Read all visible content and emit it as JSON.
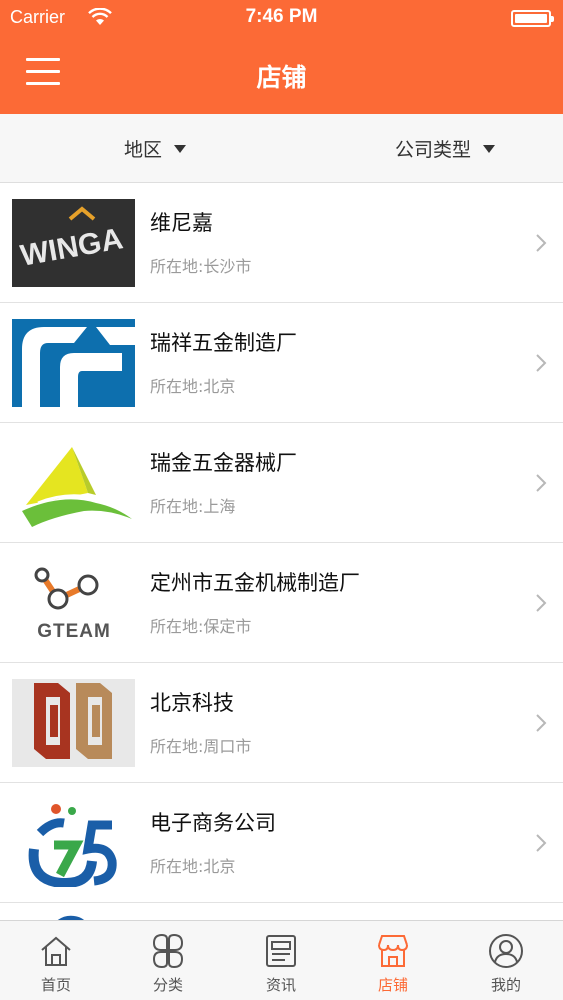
{
  "status_bar": {
    "carrier": "Carrier",
    "time": "7:46 PM"
  },
  "header": {
    "title": "店铺",
    "menu_icon": "hamburger-icon"
  },
  "filters": {
    "region": "地区",
    "company_type": "公司类型"
  },
  "shops": [
    {
      "name": "维尼嘉",
      "location": "所在地:长沙市",
      "logo_text": "WINGA"
    },
    {
      "name": "瑞祥五金制造厂",
      "location": "所在地:北京"
    },
    {
      "name": "瑞金五金器械厂",
      "location": "所在地:上海"
    },
    {
      "name": "定州市五金机械制造厂",
      "location": "所在地:保定市",
      "logo_text": "GTEAM"
    },
    {
      "name": "北京科技",
      "location": "所在地:周口市"
    },
    {
      "name": "电子商务公司",
      "location": "所在地:北京"
    }
  ],
  "tabbar": {
    "active": "店铺",
    "items": [
      {
        "label": "首页",
        "icon": "home-icon"
      },
      {
        "label": "分类",
        "icon": "category-icon"
      },
      {
        "label": "资讯",
        "icon": "news-icon"
      },
      {
        "label": "店铺",
        "icon": "shop-icon"
      },
      {
        "label": "我的",
        "icon": "profile-icon"
      }
    ]
  },
  "colors": {
    "accent": "#fc6a36",
    "text": "#111111",
    "muted": "#9a9a9a"
  }
}
